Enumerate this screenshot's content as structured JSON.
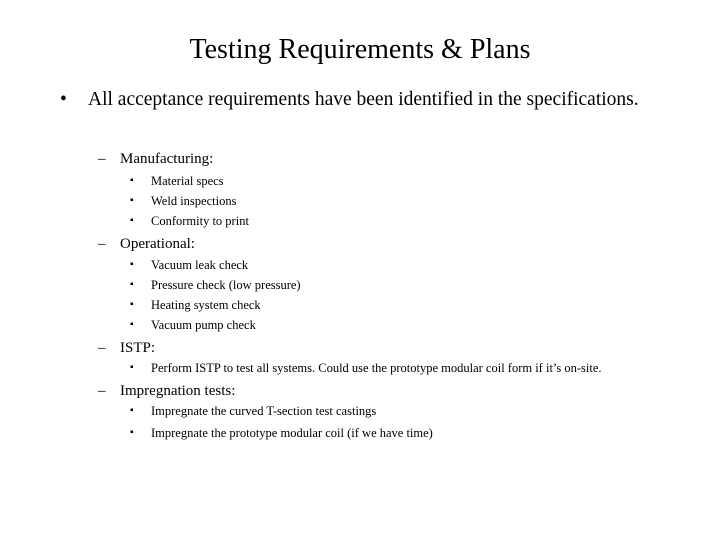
{
  "slide": {
    "title": "Testing Requirements & Plans",
    "main_bullet": {
      "marker": "•",
      "text": "All acceptance requirements have been identified in the specifications."
    },
    "sections": [
      {
        "marker": "–",
        "heading": "Manufacturing:",
        "items": [
          {
            "marker": "▪",
            "text": "Material specs"
          },
          {
            "marker": "▪",
            "text": "Weld inspections"
          },
          {
            "marker": "▪",
            "text": "Conformity to print"
          }
        ]
      },
      {
        "marker": "–",
        "heading": "Operational:",
        "items": [
          {
            "marker": "▪",
            "text": "Vacuum leak check"
          },
          {
            "marker": "▪",
            "text": "Pressure check (low pressure)"
          },
          {
            "marker": "▪",
            "text": "Heating system check"
          },
          {
            "marker": "▪",
            "text": "Vacuum pump check"
          }
        ]
      },
      {
        "marker": "–",
        "heading": "ISTP:",
        "items": [
          {
            "marker": "▪",
            "text": "Perform ISTP to test all systems.  Could use the prototype modular coil form if it’s on-site."
          }
        ]
      },
      {
        "marker": "–",
        "heading": "Impregnation tests:",
        "items": [
          {
            "marker": "▪",
            "text": "Impregnate the curved T-section test castings"
          },
          {
            "marker": "▪",
            "text": "Impregnate the prototype modular coil (if we have time)"
          }
        ]
      }
    ]
  }
}
